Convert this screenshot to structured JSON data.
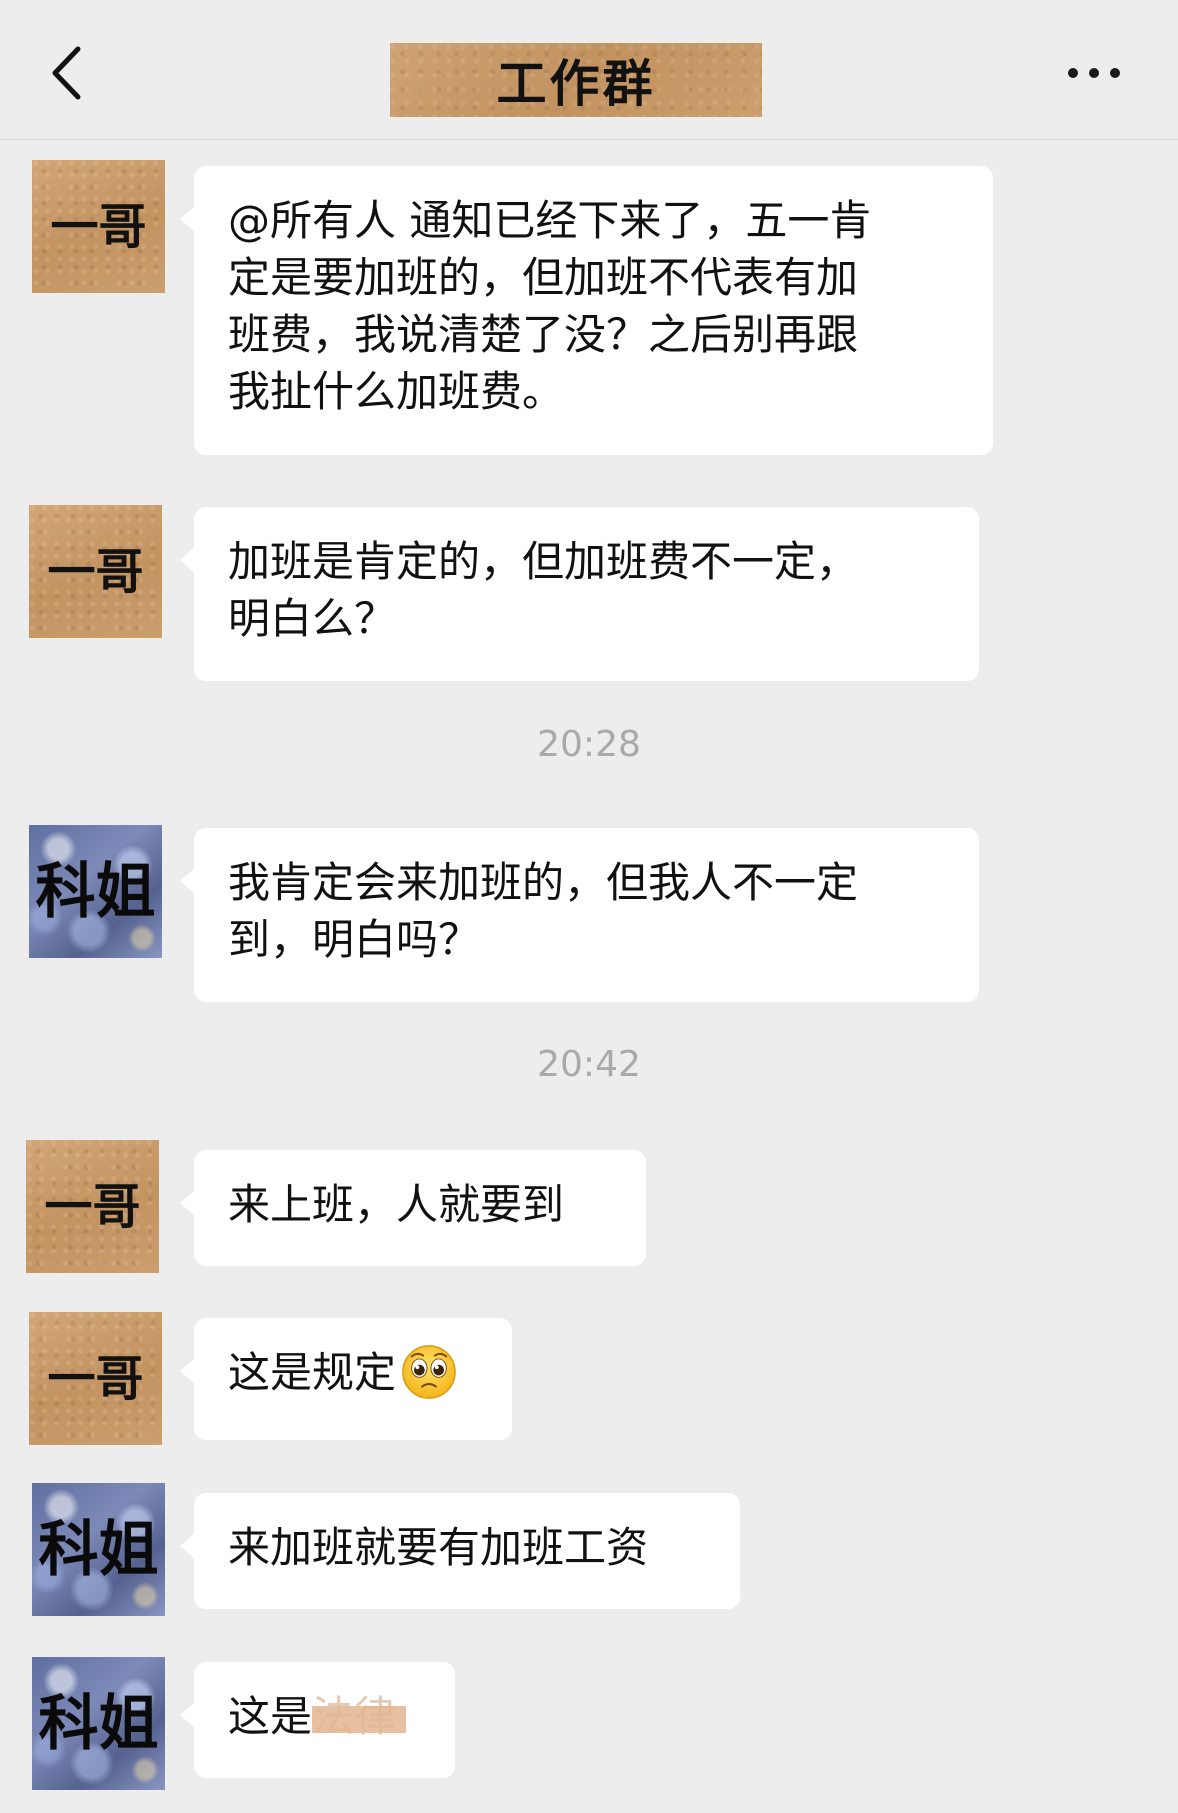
{
  "header": {
    "title": "工作群",
    "back_icon": "chevron-left-icon",
    "more_icon": "ellipsis-icon"
  },
  "messages": [
    {
      "sender": "一哥",
      "text": "@所有人 通知已经下来了，五一肯\n定是要加班的，但加班不代表有加\n班费，我说清楚了没？之后别再跟\n我扯什么加班费。"
    },
    {
      "sender": "一哥",
      "text": "加班是肯定的，但加班费不一定，\n明白么？"
    },
    {
      "sender": "科姐",
      "text": "我肯定会来加班的，但我人不一定\n到，明白吗？"
    },
    {
      "sender": "一哥",
      "text": "来上班，人就要到"
    },
    {
      "sender": "一哥",
      "text": "这是规定",
      "emoji": "pleading-face-emoji"
    },
    {
      "sender": "科姐",
      "text": "来加班就要有加班工资"
    },
    {
      "sender": "科姐",
      "text": "这是",
      "redacted_text": "法律"
    }
  ],
  "timestamps": [
    "20:28",
    "20:42"
  ],
  "colors": {
    "background": "#ededed",
    "bubble": "#ffffff",
    "timestamp": "#a9a9a9",
    "avatar_brown": "#c89d6b",
    "avatar_blue": "#6f7cab"
  }
}
